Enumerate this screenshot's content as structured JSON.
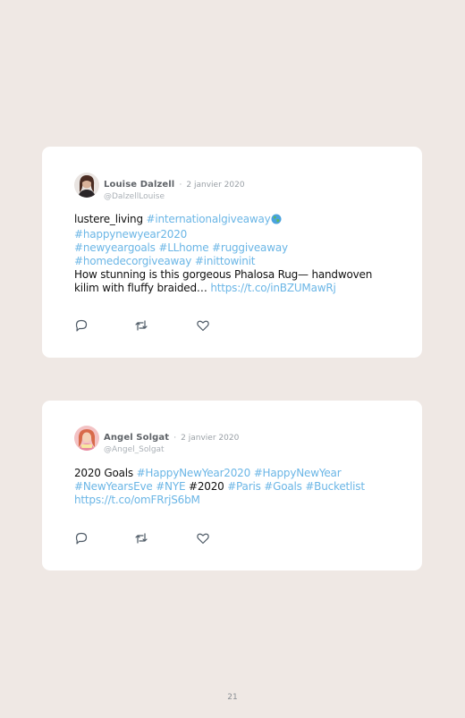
{
  "tweets": [
    {
      "author": "Louise Dalzell",
      "separator": "·",
      "date": "2 janvier 2020",
      "handle": "@DalzellLouise",
      "text": {
        "lead": "lustere_living ",
        "t1": "#internationalgiveaway",
        "t2": "#happynewyear2020",
        "t3": "#newyeargoals",
        "t4": "#LLhome",
        "t5": "#ruggiveaway",
        "t6": "#homedecorgiveaway",
        "t7": "#inittowinit",
        "line4": "How stunning is this gorgeous Phalosa Rug— handwoven",
        "line5": "kilim with fluffy braided… ",
        "link": "https://t.co/inBZUMawRj"
      },
      "icons": [
        "reply-icon",
        "retweet-icon",
        "heart-icon",
        "globe-emoji"
      ]
    },
    {
      "author": "Angel Solgat",
      "separator": "·",
      "date": "2 janvier 2020",
      "handle": "@Angel_Solgat",
      "text": {
        "lead": "2020 Goals ",
        "t1": "#HappyNewYear2020",
        "t2": "#HappyNewYear",
        "t3": "#NewYearsEve",
        "t4": "#NYE",
        "plain": "#2020",
        "t5": "#Paris",
        "t6": "#Goals",
        "t7": "#Bucketlist",
        "link": "https://t.co/omFRrjS6bM"
      },
      "icons": [
        "reply-icon",
        "retweet-icon",
        "heart-icon"
      ]
    }
  ],
  "page_number": "21",
  "colors": {
    "background": "#efe8e4",
    "card": "#ffffff",
    "hashtag": "#6bb6e6",
    "text": "#111111",
    "muted": "#9aa0a6"
  }
}
